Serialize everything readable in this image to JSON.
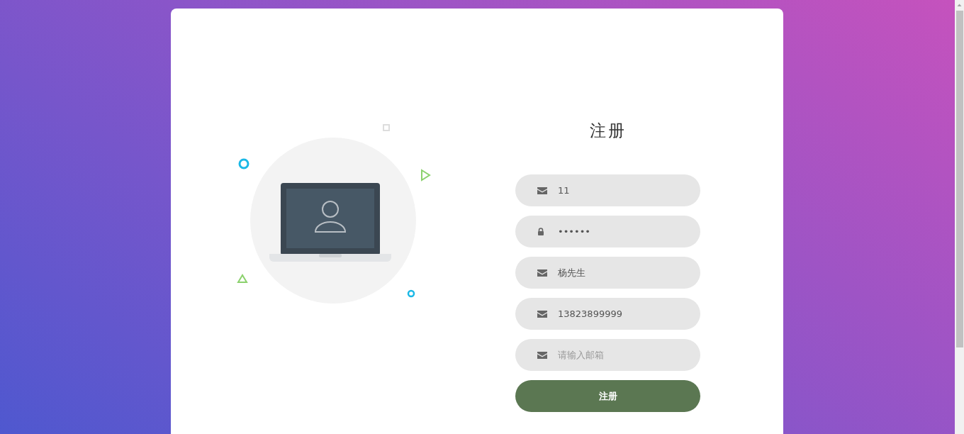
{
  "form": {
    "title": "注册",
    "fields": [
      {
        "kind": "email",
        "value": "11"
      },
      {
        "kind": "password",
        "value": "••••••"
      },
      {
        "kind": "email",
        "value": "杨先生"
      },
      {
        "kind": "email",
        "value": "13823899999"
      },
      {
        "kind": "email",
        "placeholder": "请输入邮箱"
      }
    ],
    "submit": "注册"
  }
}
